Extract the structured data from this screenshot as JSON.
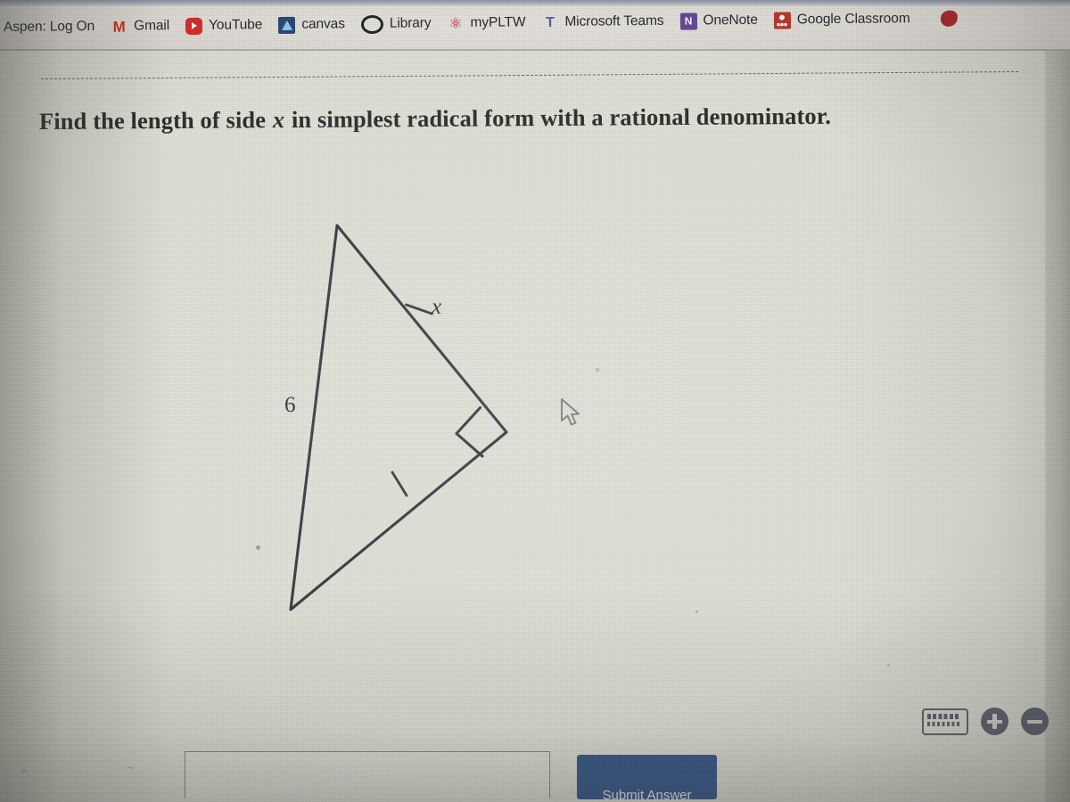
{
  "browser": {
    "bookmarks": [
      {
        "label": "Aspen: Log On",
        "icon": "none"
      },
      {
        "label": "Gmail",
        "icon": "gmail-icon"
      },
      {
        "label": "YouTube",
        "icon": "youtube-icon"
      },
      {
        "label": "canvas",
        "icon": "canvas-icon"
      },
      {
        "label": "Library",
        "icon": "library-ring-icon"
      },
      {
        "label": "myPLTW",
        "icon": "atom-icon"
      },
      {
        "label": "Microsoft Teams",
        "icon": "microsoft-teams-icon"
      },
      {
        "label": "OneNote",
        "icon": "onenote-icon"
      },
      {
        "label": "Google Classroom",
        "icon": "google-classroom-icon"
      },
      {
        "label": "",
        "icon": "extension-blob-icon"
      }
    ],
    "onenote_glyph": "N",
    "teams_glyph": "T"
  },
  "question": {
    "prefix": "Find the length of side ",
    "variable": "x",
    "suffix": " in simplest radical form with a rational denominator."
  },
  "figure": {
    "type": "right-triangle",
    "labels": {
      "hypotenuse": "6",
      "unknown_leg": "x"
    },
    "stroke_color": "#3a3c44",
    "vertices": {
      "top": [
        378,
        253
      ],
      "right": [
        568,
        485
      ],
      "bottom_left": [
        326,
        684
      ]
    },
    "right_angle_at": "right",
    "congruent_tick_marks": 2,
    "tick_positions": [
      [
        470,
        366
      ],
      [
        448,
        581
      ]
    ]
  },
  "answer_area": {
    "input_value": "",
    "input_placeholder": "",
    "submit_label": "Submit Answer"
  },
  "zoom_controls": {
    "keyboard_label": "keyboard-icon",
    "zoom_in_label": "+",
    "zoom_out_label": "−"
  },
  "colors": {
    "page_background": "#e3e4da",
    "chrome_background": "#eae7e1",
    "ink": "#30302e",
    "figure_stroke": "#3a3c44",
    "submit_button": "#3b5e90"
  }
}
